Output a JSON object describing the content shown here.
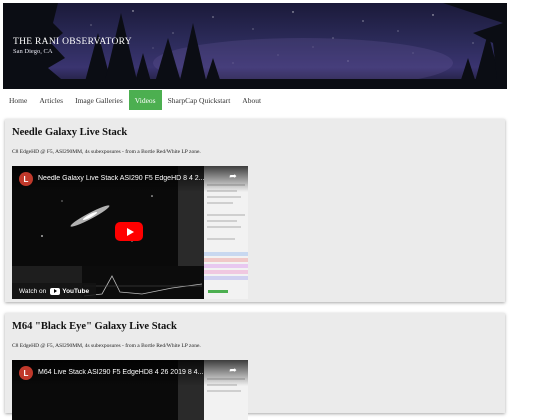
{
  "banner": {
    "title": "THE RANI OBSERVATORY",
    "subtitle": "San Diego, CA"
  },
  "nav": {
    "items": [
      {
        "label": "Home",
        "active": false
      },
      {
        "label": "Articles",
        "active": false
      },
      {
        "label": "Image Galleries",
        "active": false
      },
      {
        "label": "Videos",
        "active": true
      },
      {
        "label": "SharpCap Quickstart",
        "active": false
      },
      {
        "label": "About",
        "active": false
      }
    ]
  },
  "posts": [
    {
      "title": "Needle Galaxy Live Stack",
      "description": "C8 EdgeHD @ F5, ASI290MM, 4s subexposures - from a Bortle Red/White LP zone.",
      "video": {
        "channel_initial": "L",
        "title": "Needle Galaxy Live Stack ASI290 F5 EdgeHD 8 4 2...",
        "watch_on": "Watch on",
        "youtube": "YouTube"
      }
    },
    {
      "title": "M64 \"Black Eye\" Galaxy Live Stack",
      "description": "C8 EdgeHD @ F5, ASI290MM, 4s subexposures - from a Bortle Red/White LP zone.",
      "video": {
        "channel_initial": "L",
        "title": "M64 Live Stack ASI290 F5 EdgeHD8 4 26 2019 8 4..."
      }
    }
  ]
}
